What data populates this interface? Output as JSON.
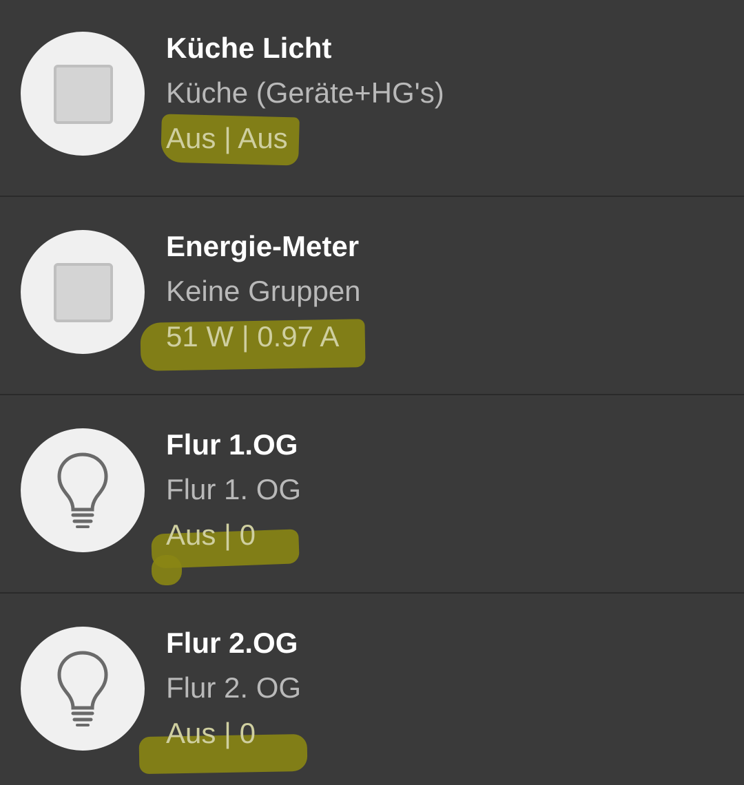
{
  "devices": [
    {
      "title": "Küche Licht",
      "subtitle": "Küche (Geräte+HG's)",
      "status": "Aus | Aus",
      "icon": "switch-square-icon"
    },
    {
      "title": "Energie-Meter",
      "subtitle": "Keine Gruppen",
      "status": "51 W | 0.97 A",
      "icon": "switch-square-icon"
    },
    {
      "title": "Flur 1.OG",
      "subtitle": "Flur 1. OG",
      "status": "Aus | 0",
      "icon": "light-bulb-icon"
    },
    {
      "title": "Flur 2.OG",
      "subtitle": "Flur 2. OG",
      "status": "Aus | 0",
      "icon": "light-bulb-icon"
    }
  ],
  "colors": {
    "background": "#3a3a3a",
    "title": "#ffffff",
    "subtitle": "#b9b9b9",
    "highlight_marker": "#8a8614",
    "avatar": "#f0f0f0"
  }
}
